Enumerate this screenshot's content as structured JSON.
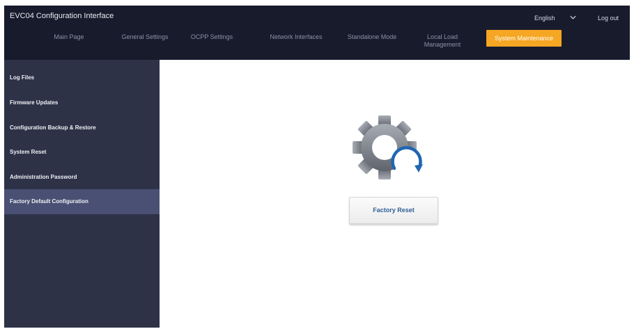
{
  "header": {
    "title": "EVC04 Configuration Interface",
    "language": "English",
    "logout": "Log out"
  },
  "nav": {
    "items": [
      {
        "label": "Main Page"
      },
      {
        "label": "General Settings"
      },
      {
        "label": "OCPP Settings"
      },
      {
        "label": "Network Interfaces"
      },
      {
        "label": "Standalone Mode"
      },
      {
        "label": "Local Load Management"
      },
      {
        "label": "System Maintenance",
        "active": true
      }
    ]
  },
  "sidebar": {
    "items": [
      {
        "label": "Log Files"
      },
      {
        "label": "Firmware Updates"
      },
      {
        "label": "Configuration Backup & Restore"
      },
      {
        "label": "System Reset"
      },
      {
        "label": "Administration Password"
      },
      {
        "label": "Factory Default Configuration",
        "active": true
      }
    ]
  },
  "main": {
    "button_label": "Factory Reset",
    "icon": "gear-refresh-icon"
  },
  "colors": {
    "header_bg": "#181b2c",
    "accent": "#f5a623",
    "sidebar_bg": "#2d3247",
    "sidebar_active": "#4a5073",
    "button_text": "#2f5e96"
  }
}
